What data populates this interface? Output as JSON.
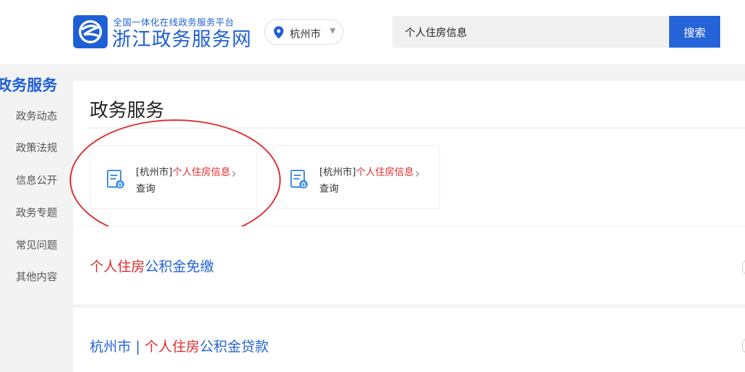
{
  "header": {
    "site_subtitle": "全国一体化在线政务服务平台",
    "site_name": "浙江政务服务网",
    "city": "杭州市",
    "search_value": "个人住房信息",
    "search_button": "搜索"
  },
  "sidebar": {
    "title": "政务服务",
    "items": [
      {
        "label": "政务动态"
      },
      {
        "label": "政策法规"
      },
      {
        "label": "信息公开"
      },
      {
        "label": "政务专题"
      },
      {
        "label": "常见问题"
      },
      {
        "label": "其他内容"
      }
    ]
  },
  "main": {
    "title": "政务服务",
    "services": [
      {
        "prefix": "[杭州市]",
        "highlight": "个人住房信息",
        "suffix": "查询"
      },
      {
        "prefix": "[杭州市]",
        "highlight": "个人住房信息",
        "suffix": "查询"
      }
    ]
  },
  "results": [
    {
      "parts": [
        {
          "text": "个人住房",
          "color": "red"
        },
        {
          "text": "公积金免缴",
          "color": "blue"
        }
      ]
    },
    {
      "parts": [
        {
          "text": "杭州市 | ",
          "color": "blue"
        },
        {
          "text": "个人住房",
          "color": "red"
        },
        {
          "text": "公积金贷款",
          "color": "blue"
        }
      ]
    }
  ],
  "colors": {
    "accent": "#2463d8",
    "highlight": "#e02b2b",
    "annotation": "#e02b2b"
  }
}
